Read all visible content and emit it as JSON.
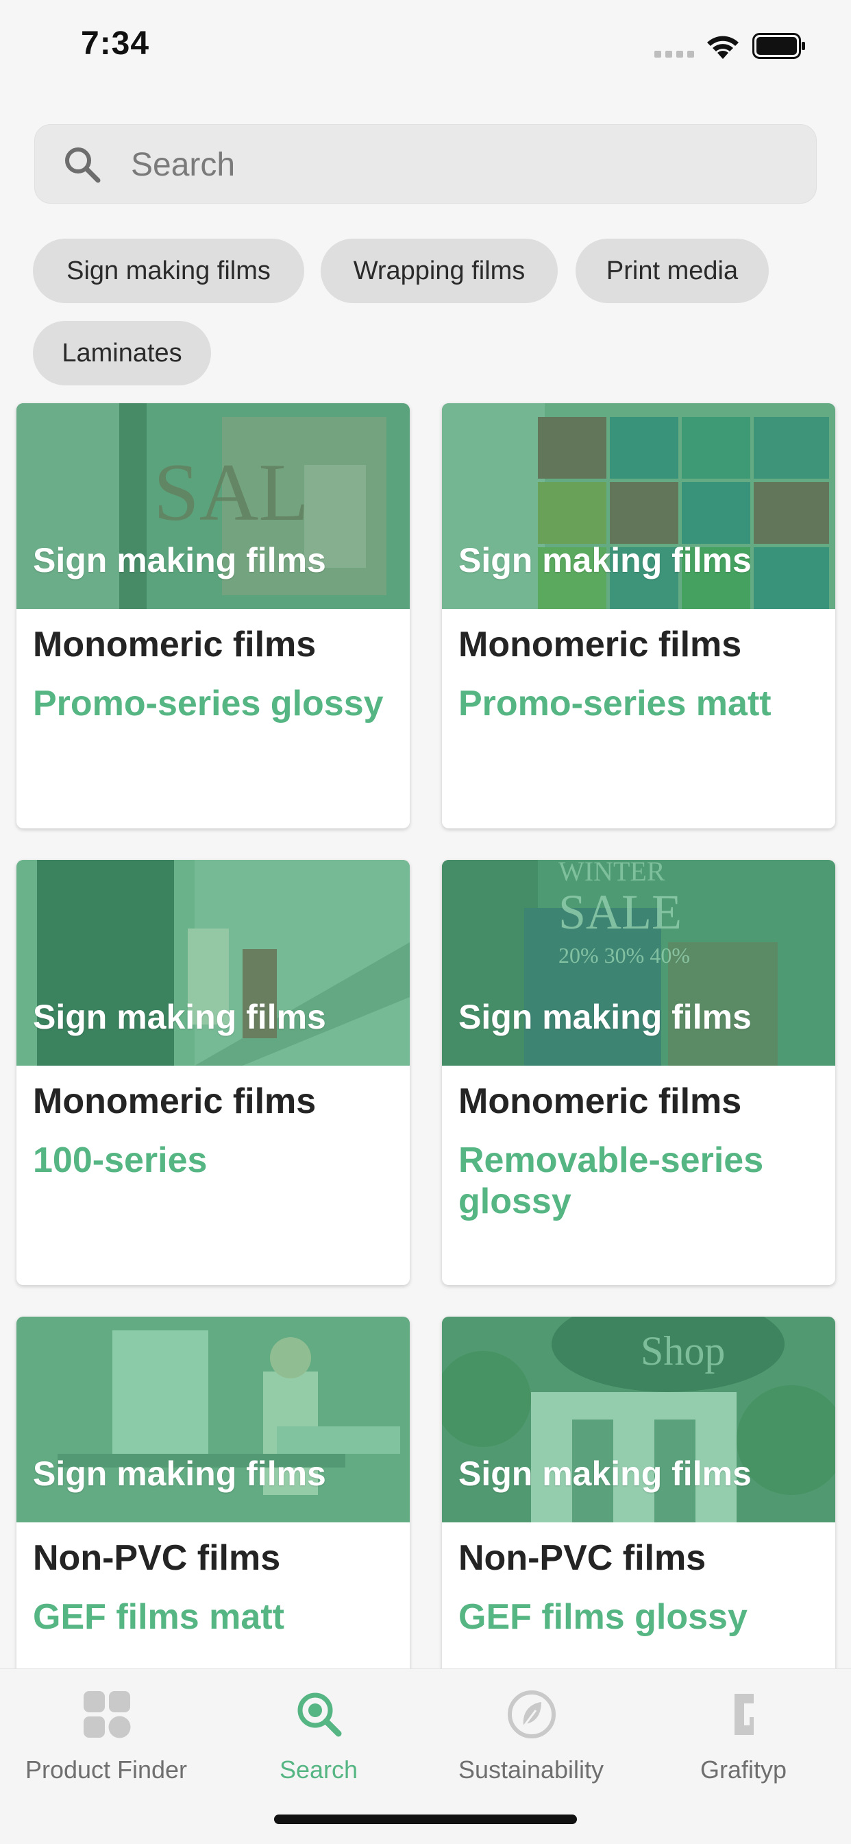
{
  "status_bar": {
    "time": "7:34"
  },
  "search": {
    "placeholder": "Search",
    "value": ""
  },
  "filters": [
    "Sign making films",
    "Wrapping films",
    "Print media",
    "Laminates"
  ],
  "products": [
    {
      "category": "Sign making films",
      "type": "Monomeric films",
      "name": "Promo-series glossy",
      "image": "sale-window-photo"
    },
    {
      "category": "Sign making films",
      "type": "Monomeric films",
      "name": "Promo-series matt",
      "image": "expo-hall-signs-photo"
    },
    {
      "category": "Sign making films",
      "type": "Monomeric films",
      "name": "100-series",
      "image": "escalator-signage-photo"
    },
    {
      "category": "Sign making films",
      "type": "Monomeric films",
      "name": "Removable-series glossy",
      "image": "winter-sale-window-photo"
    },
    {
      "category": "Sign making films",
      "type": "Non-PVC films",
      "name": "GEF films matt",
      "image": "golf-counter-photo"
    },
    {
      "category": "Sign making films",
      "type": "Non-PVC films",
      "name": "GEF films glossy",
      "image": "coffee-shop-sign-photo"
    }
  ],
  "tabs": [
    {
      "label": "Product Finder",
      "icon": "grid-icon",
      "active": false
    },
    {
      "label": "Search",
      "icon": "search-icon",
      "active": true
    },
    {
      "label": "Sustainability",
      "icon": "leaf-icon",
      "active": false
    },
    {
      "label": "Grafityp",
      "icon": "grafityp-logo-icon",
      "active": false
    }
  ],
  "colors": {
    "accent": "#55b583",
    "overlay": "#4eb47e",
    "inactive": "#6f6f6f"
  }
}
